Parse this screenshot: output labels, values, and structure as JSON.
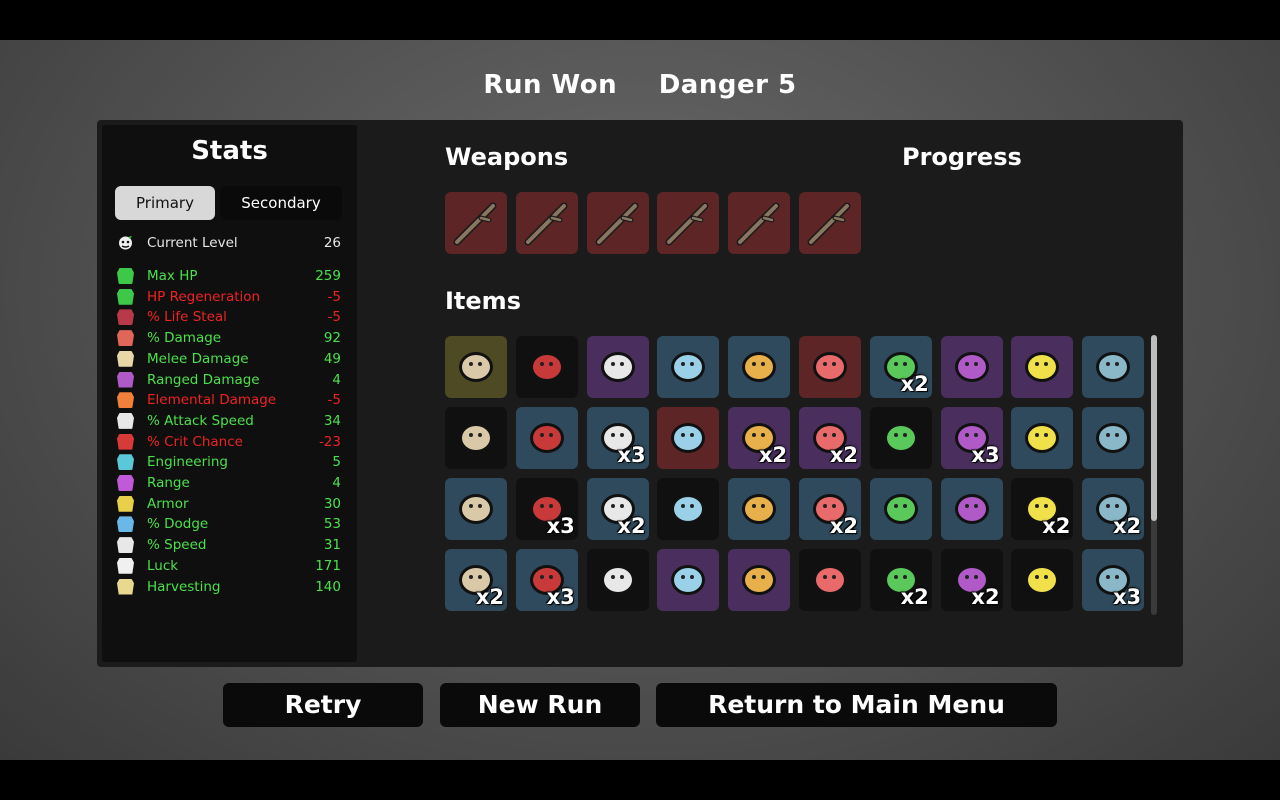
{
  "header": {
    "status": "Run Won",
    "danger": "Danger 5"
  },
  "stats": {
    "title": "Stats",
    "tabs": {
      "primary": "Primary",
      "secondary": "Secondary"
    },
    "current_level": {
      "label": "Current Level",
      "value": "26"
    },
    "rows": [
      {
        "label": "Max HP",
        "value": "259",
        "tone": "pos",
        "icon": "heart-icon",
        "color": "#3ec84a"
      },
      {
        "label": "HP Regeneration",
        "value": "-5",
        "tone": "neg",
        "icon": "regen-heart-icon",
        "color": "#3ec84a"
      },
      {
        "label": "% Life Steal",
        "value": "-5",
        "tone": "neg",
        "icon": "fangs-icon",
        "color": "#b83a4a"
      },
      {
        "label": "% Damage",
        "value": "92",
        "tone": "pos",
        "icon": "muscle-icon",
        "color": "#e0665a"
      },
      {
        "label": "Melee Damage",
        "value": "49",
        "tone": "pos",
        "icon": "sword-icon",
        "color": "#e8d8a8"
      },
      {
        "label": "Ranged Damage",
        "value": "4",
        "tone": "pos",
        "icon": "bow-icon",
        "color": "#b05ac8"
      },
      {
        "label": "Elemental Damage",
        "value": "-5",
        "tone": "neg",
        "icon": "flame-icon",
        "color": "#f0803a"
      },
      {
        "label": "% Attack Speed",
        "value": "34",
        "tone": "pos",
        "icon": "hourglass-icon",
        "color": "#e8e8e8"
      },
      {
        "label": "% Crit Chance",
        "value": "-23",
        "tone": "neg",
        "icon": "crit-burst-icon",
        "color": "#d83a3a"
      },
      {
        "label": "Engineering",
        "value": "5",
        "tone": "pos",
        "icon": "wrench-icon",
        "color": "#5ac8d8"
      },
      {
        "label": "Range",
        "value": "4",
        "tone": "pos",
        "icon": "range-waves-icon",
        "color": "#c05ad8"
      },
      {
        "label": "Armor",
        "value": "30",
        "tone": "pos",
        "icon": "shield-icon",
        "color": "#e8d04a"
      },
      {
        "label": "% Dodge",
        "value": "53",
        "tone": "pos",
        "icon": "dash-icon",
        "color": "#6ab8e8"
      },
      {
        "label": "% Speed",
        "value": "31",
        "tone": "pos",
        "icon": "boot-icon",
        "color": "#e8e8e8"
      },
      {
        "label": "Luck",
        "value": "171",
        "tone": "pos",
        "icon": "dice-icon",
        "color": "#f0f0f0"
      },
      {
        "label": "Harvesting",
        "value": "140",
        "tone": "pos",
        "icon": "wheat-icon",
        "color": "#e8d890"
      }
    ]
  },
  "weapons": {
    "title": "Weapons",
    "items": [
      {
        "name": "stick-icon"
      },
      {
        "name": "stick-icon"
      },
      {
        "name": "stick-icon"
      },
      {
        "name": "stick-icon"
      },
      {
        "name": "stick-icon"
      },
      {
        "name": "stick-icon"
      }
    ]
  },
  "progress": {
    "title": "Progress"
  },
  "items": {
    "title": "Items",
    "list": [
      {
        "icon": "potato-icon",
        "tier": "olive",
        "count": ""
      },
      {
        "icon": "syringe-icon",
        "tier": "black",
        "count": ""
      },
      {
        "icon": "tools-icon",
        "tier": "purple",
        "count": ""
      },
      {
        "icon": "bone-chain-icon",
        "tier": "blue",
        "count": ""
      },
      {
        "icon": "fortress-icon",
        "tier": "blue",
        "count": ""
      },
      {
        "icon": "octopus-icon",
        "tier": "red",
        "count": ""
      },
      {
        "icon": "helmet-plate-icon",
        "tier": "blue",
        "count": "x2"
      },
      {
        "icon": "claw-scratch-icon",
        "tier": "purple",
        "count": ""
      },
      {
        "icon": "bowler-hat-icon",
        "tier": "purple",
        "count": ""
      },
      {
        "icon": "sick-critter-icon",
        "tier": "blue",
        "count": ""
      },
      {
        "icon": "cake-slice-icon",
        "tier": "black",
        "count": ""
      },
      {
        "icon": "snail-icon",
        "tier": "blue",
        "count": ""
      },
      {
        "icon": "potion-flask-icon",
        "tier": "blue",
        "count": "x3"
      },
      {
        "icon": "anvil-icon",
        "tier": "red",
        "count": ""
      },
      {
        "icon": "wings-icon",
        "tier": "purple",
        "count": "x2"
      },
      {
        "icon": "rocket-icon",
        "tier": "purple",
        "count": "x2"
      },
      {
        "icon": "rubber-duck-icon",
        "tier": "black",
        "count": ""
      },
      {
        "icon": "clover-icon",
        "tier": "purple",
        "count": "x3"
      },
      {
        "icon": "robot-arm-icon",
        "tier": "blue",
        "count": ""
      },
      {
        "icon": "frog-icon",
        "tier": "blue",
        "count": ""
      },
      {
        "icon": "ketchup-bottle-icon",
        "tier": "blue",
        "count": ""
      },
      {
        "icon": "propeller-cap-icon",
        "tier": "black",
        "count": "x3"
      },
      {
        "icon": "glass-bottle-icon",
        "tier": "blue",
        "count": "x2"
      },
      {
        "icon": "lizard-icon",
        "tier": "black",
        "count": ""
      },
      {
        "icon": "red-ring-icon",
        "tier": "blue",
        "count": ""
      },
      {
        "icon": "wheelbarrow-icon",
        "tier": "blue",
        "count": "x2"
      },
      {
        "icon": "rabbit-icon",
        "tier": "blue",
        "count": ""
      },
      {
        "icon": "shards-icon",
        "tier": "blue",
        "count": ""
      },
      {
        "icon": "poison-syringe-icon",
        "tier": "black",
        "count": "x2"
      },
      {
        "icon": "sausage-link-icon",
        "tier": "blue",
        "count": "x2"
      },
      {
        "icon": "necklace-icon",
        "tier": "blue",
        "count": "x2"
      },
      {
        "icon": "dark-eyes-icon",
        "tier": "blue",
        "count": "x3"
      },
      {
        "icon": "crescent-icon",
        "tier": "black",
        "count": ""
      },
      {
        "icon": "holy-amulet-icon",
        "tier": "purple",
        "count": ""
      },
      {
        "icon": "fabric-cloth-icon",
        "tier": "purple",
        "count": ""
      },
      {
        "icon": "skull-mask-icon",
        "tier": "black",
        "count": ""
      },
      {
        "icon": "red-blade-icon",
        "tier": "black",
        "count": "x2"
      },
      {
        "icon": "bandaged-potato-icon",
        "tier": "black",
        "count": "x2"
      },
      {
        "icon": "jar-icon",
        "tier": "black",
        "count": ""
      },
      {
        "icon": "worm-icon",
        "tier": "blue",
        "count": "x3"
      }
    ]
  },
  "buttons": {
    "retry": "Retry",
    "new_run": "New Run",
    "main_menu": "Return to Main Menu"
  },
  "colors": {
    "positive": "#4be04b",
    "negative": "#ee2222",
    "tier_red": "#5e2527",
    "tier_blue": "#2e4a5c",
    "tier_purple": "#4a2f5e",
    "tier_black": "#101010"
  }
}
